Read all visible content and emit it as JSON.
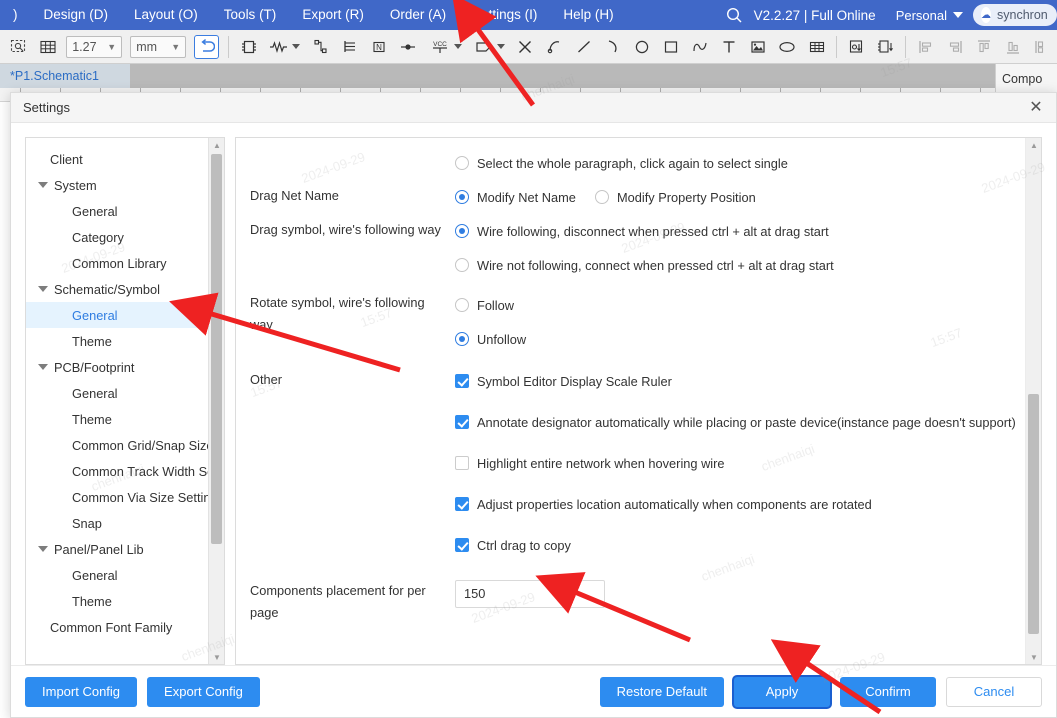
{
  "app": {
    "menu": [
      {
        "label": ")"
      },
      {
        "label": "Design (D)"
      },
      {
        "label": "Layout (O)"
      },
      {
        "label": "Tools (T)"
      },
      {
        "label": "Export (R)"
      },
      {
        "label": "Order (A)"
      },
      {
        "label": "Settings (I)"
      },
      {
        "label": "Help (H)"
      }
    ],
    "search_icon": "search-icon",
    "version": "V2.2.27 | Full Online",
    "account": "Personal",
    "sync_label": "synchron",
    "cloud_icon": "cloud-sync-icon"
  },
  "toolbar": {
    "grid_size_value": "1.27",
    "unit_value": "mm",
    "icons": [
      "select-area-icon",
      "grid-icon",
      "undo-toggle-icon",
      "component-icon",
      "resistor-icon",
      "wire-icon",
      "bus-icon",
      "netlabel-icon",
      "junction-icon",
      "vcc-icon",
      "port-icon",
      "no-connect-icon",
      "polyline-icon",
      "line-icon",
      "arc-icon",
      "circle-icon",
      "rectangle-icon",
      "curve-icon",
      "text-icon",
      "image-icon",
      "ellipse-icon",
      "table-icon",
      "place-part-icon",
      "place-device-icon",
      "align-left-icon",
      "align-right-icon",
      "align-top-icon",
      "align-bottom-icon",
      "align-grid-icon"
    ]
  },
  "tabs": [
    {
      "label": "*P1.Schematic1",
      "active": true
    }
  ],
  "right_panel": {
    "title": "Compo"
  },
  "dialog": {
    "title": "Settings",
    "close_icon": "close-icon",
    "tree": [
      {
        "label": "Client",
        "depth": 0,
        "expander": false,
        "selected": false
      },
      {
        "label": "System",
        "depth": 0,
        "expander": true,
        "selected": false
      },
      {
        "label": "General",
        "depth": 1,
        "expander": false,
        "selected": false
      },
      {
        "label": "Category",
        "depth": 1,
        "expander": false,
        "selected": false
      },
      {
        "label": "Common Library",
        "depth": 1,
        "expander": false,
        "selected": false
      },
      {
        "label": "Schematic/Symbol",
        "depth": 0,
        "expander": true,
        "selected": false
      },
      {
        "label": "General",
        "depth": 1,
        "expander": false,
        "selected": true
      },
      {
        "label": "Theme",
        "depth": 1,
        "expander": false,
        "selected": false
      },
      {
        "label": "PCB/Footprint",
        "depth": 0,
        "expander": true,
        "selected": false
      },
      {
        "label": "General",
        "depth": 1,
        "expander": false,
        "selected": false
      },
      {
        "label": "Theme",
        "depth": 1,
        "expander": false,
        "selected": false
      },
      {
        "label": "Common Grid/Snap Size S",
        "depth": 1,
        "expander": false,
        "selected": false
      },
      {
        "label": "Common Track Width Settin",
        "depth": 1,
        "expander": false,
        "selected": false
      },
      {
        "label": "Common Via Size Setting",
        "depth": 1,
        "expander": false,
        "selected": false
      },
      {
        "label": "Snap",
        "depth": 1,
        "expander": false,
        "selected": false
      },
      {
        "label": "Panel/Panel Lib",
        "depth": 0,
        "expander": true,
        "selected": false
      },
      {
        "label": "General",
        "depth": 1,
        "expander": false,
        "selected": false
      },
      {
        "label": "Theme",
        "depth": 1,
        "expander": false,
        "selected": false
      },
      {
        "label": "Common Font Family",
        "depth": 0,
        "expander": false,
        "selected": false
      }
    ],
    "settings": {
      "select_paragraph": {
        "label": "Select the whole paragraph, click again to select single",
        "checked": false
      },
      "drag_net_name": {
        "label": "Drag Net Name",
        "options": [
          {
            "label": "Modify Net Name",
            "checked": true
          },
          {
            "label": "Modify Property Position",
            "checked": false
          }
        ]
      },
      "drag_symbol": {
        "label": "Drag symbol, wire's following way",
        "options": [
          {
            "label": "Wire following, disconnect when pressed ctrl + alt at drag start",
            "checked": true
          },
          {
            "label": "Wire not following, connect when pressed ctrl + alt at drag start",
            "checked": false
          }
        ]
      },
      "rotate_symbol": {
        "label": "Rotate symbol, wire's following way",
        "options": [
          {
            "label": "Follow",
            "checked": false
          },
          {
            "label": "Unfollow",
            "checked": true
          }
        ]
      },
      "other": {
        "label": "Other",
        "options": [
          {
            "label": "Symbol Editor Display Scale Ruler",
            "checked": true
          },
          {
            "label": "Annotate designator automatically while placing or paste device(instance page doesn't support)",
            "checked": true
          },
          {
            "label": "Highlight entire network when hovering wire",
            "checked": false
          },
          {
            "label": "Adjust properties location automatically when components are rotated",
            "checked": true
          },
          {
            "label": "Ctrl drag to copy",
            "checked": true
          }
        ]
      },
      "components_per_page": {
        "label": "Components placement for per page",
        "value": "150"
      }
    },
    "footer": {
      "import_config": "Import Config",
      "export_config": "Export Config",
      "restore_default": "Restore Default",
      "apply": "Apply",
      "confirm": "Confirm",
      "cancel": "Cancel"
    }
  },
  "colors": {
    "menubar_blue": "#4068c8",
    "accent_blue": "#2d8cf0",
    "selected_item_bg": "#e5f3fe",
    "selected_item_text": "#2f7de1",
    "annotation_red": "#ee2222"
  },
  "watermarks": [
    "2024-09-29",
    "15:57",
    "chenhaiqi",
    "2024-09-29",
    "chenhaiqi",
    "15:57",
    "2024-09-29",
    "chenhaiqi",
    "15:57",
    "2024-09-29",
    "chenhaiqi",
    "2024-09-29",
    "15:57",
    "chenhaiqi",
    "2024-09-29",
    "15:57",
    "chenhaiqi",
    "2024-09-29"
  ]
}
